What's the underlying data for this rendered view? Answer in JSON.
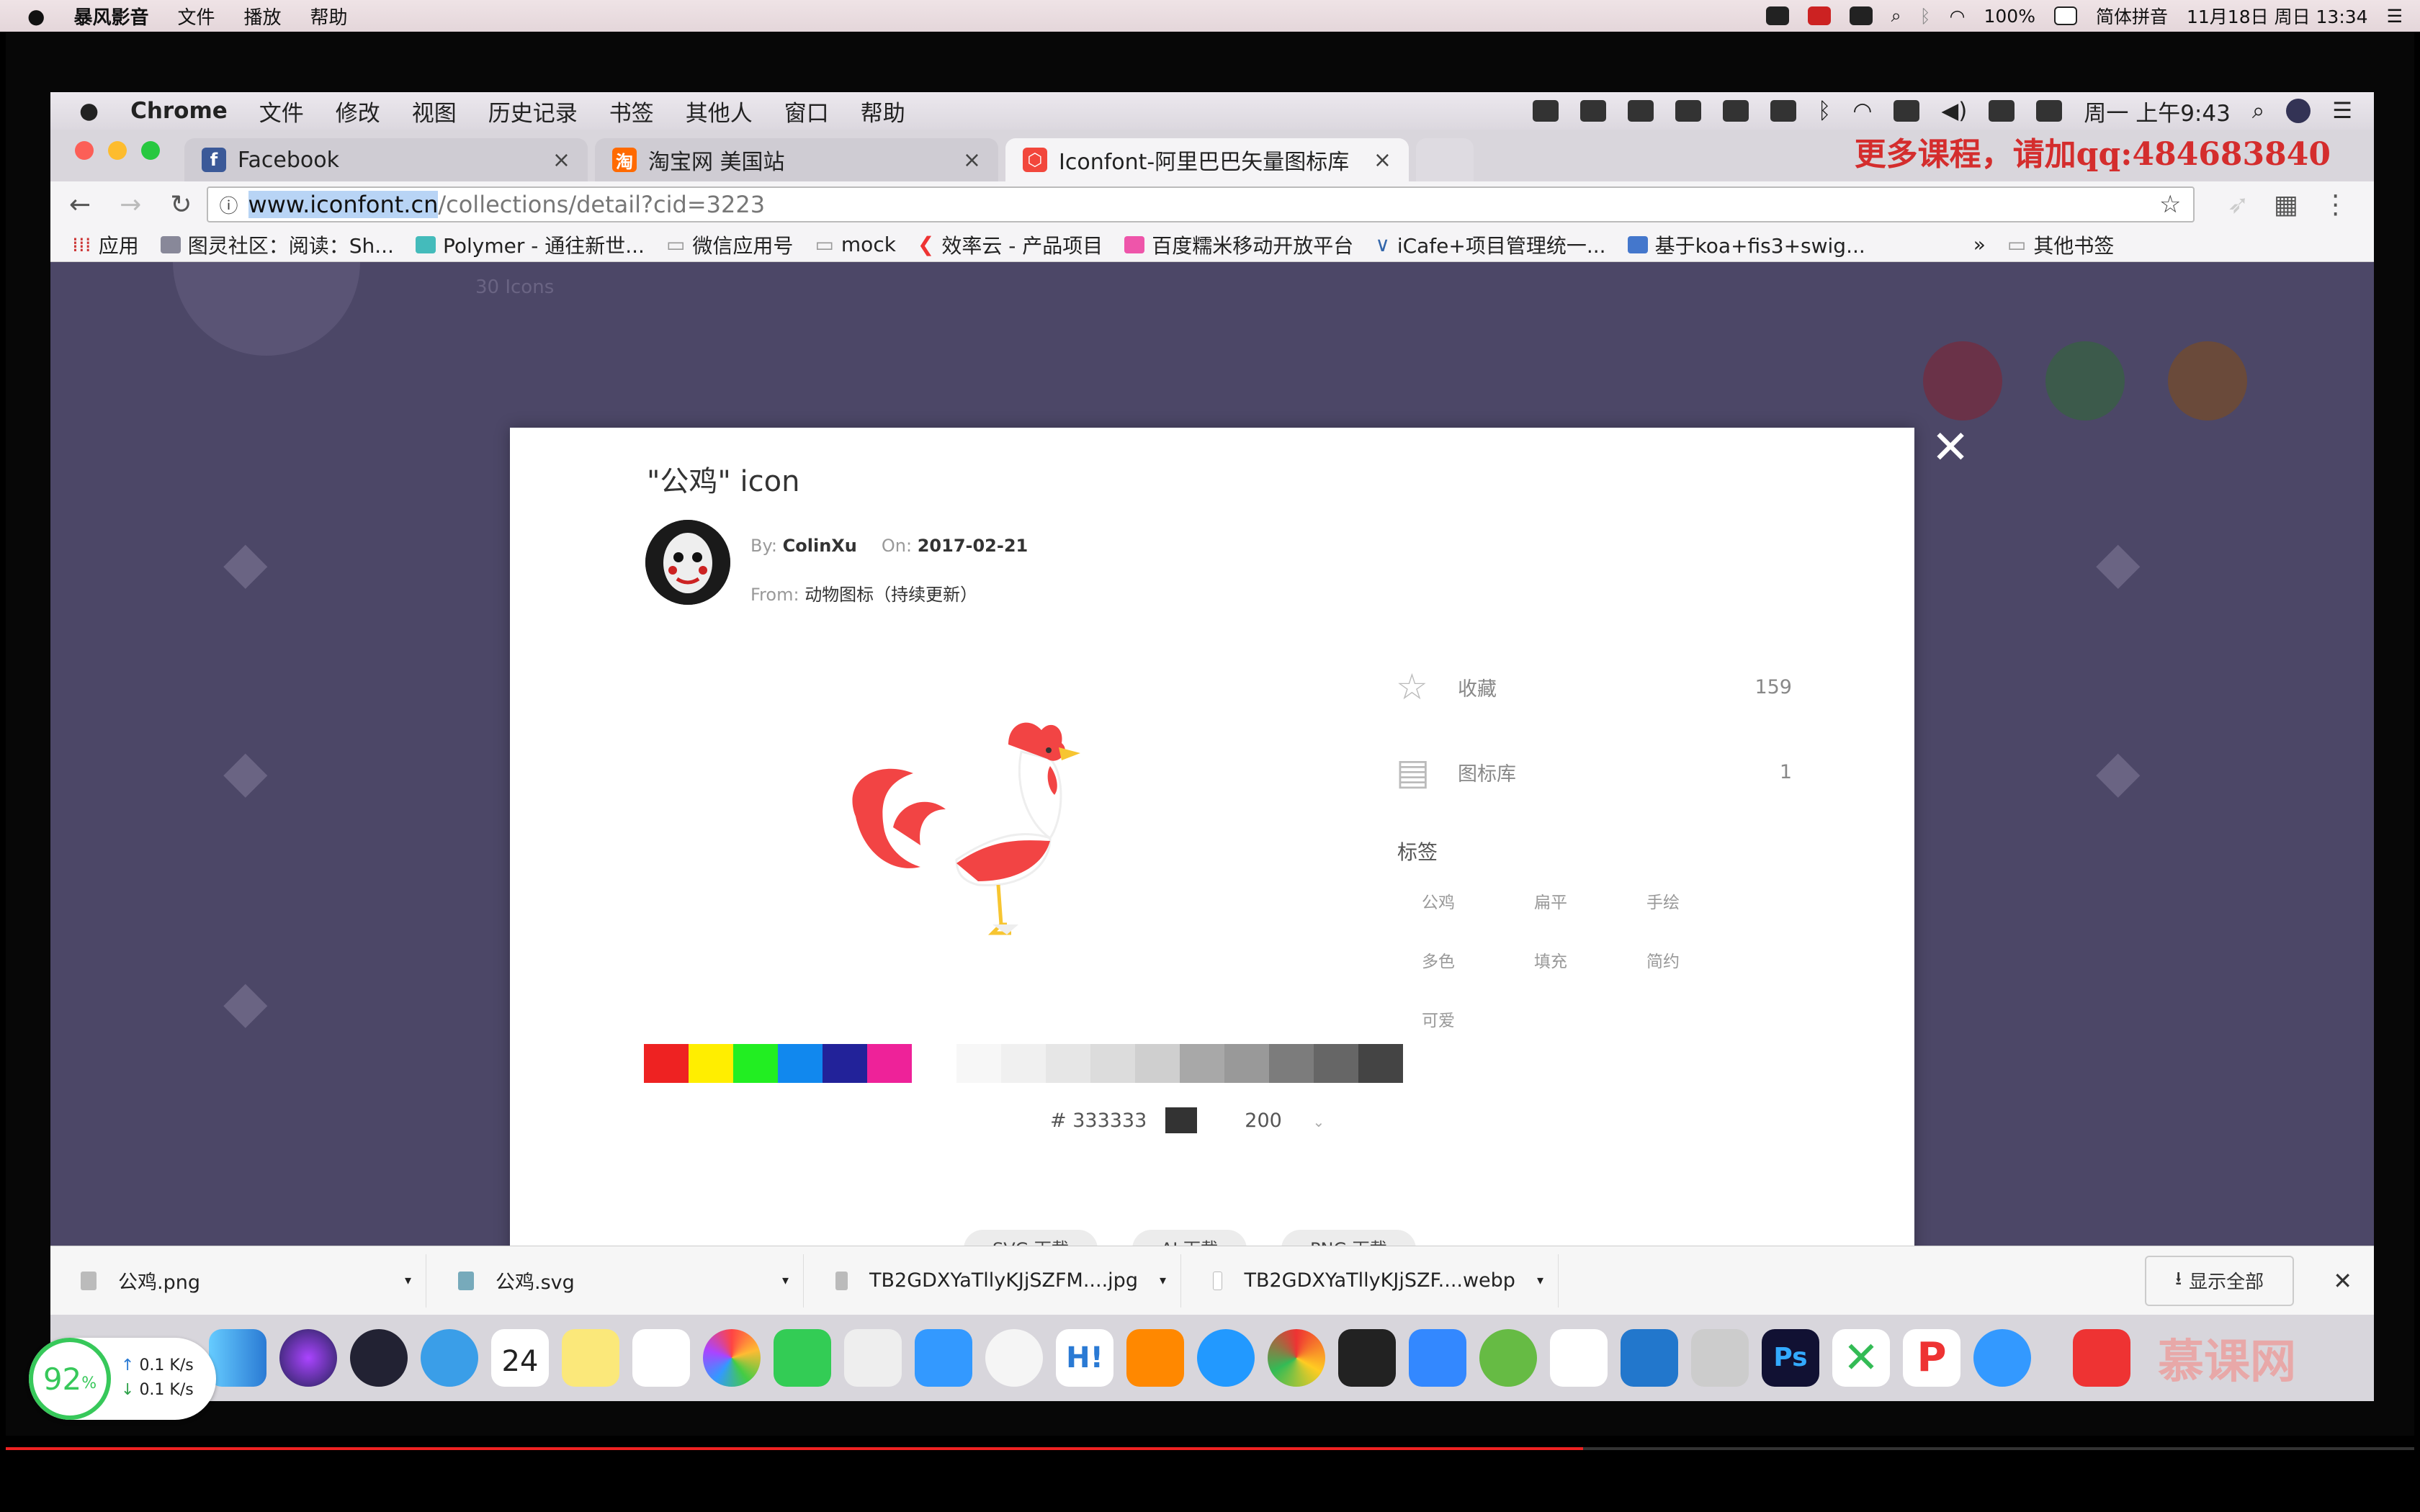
{
  "host": {
    "menus": [
      "暴风影音",
      "文件",
      "播放",
      "帮助"
    ],
    "status_right": [
      "100%",
      "简体拼音",
      "11月18日 周日 13:34"
    ]
  },
  "mac": {
    "menubar": {
      "app": "Chrome",
      "items": [
        "文件",
        "修改",
        "视图",
        "历史记录",
        "书签",
        "其他人",
        "窗口",
        "帮助"
      ],
      "clock": "周一 上午9:43"
    },
    "tabs": [
      {
        "title": "Facebook",
        "favicon_color": "#3b5998",
        "favicon": "f"
      },
      {
        "title": "淘宝网 美国站",
        "favicon_color": "#ff6a00",
        "favicon": "淘"
      },
      {
        "title": "Iconfont-阿里巴巴矢量图标库",
        "favicon_color": "#f2473c",
        "favicon": "⬡"
      }
    ],
    "promo": "更多课程，请加qq:484683840",
    "url": {
      "highlight": "www.iconfont.cn",
      "rest": "/collections/detail?cid=3223"
    },
    "bookmarks": [
      "应用",
      "图灵社区：阅读：Sh...",
      "Polymer - 通往新世...",
      "微信应用号",
      "mock",
      "效率云 - 产品项目",
      "百度糯米移动开放平台",
      "iCafe+项目管理统一...",
      "基于koa+fis3+swig...",
      "其他书签"
    ],
    "bg_text": "30 Icons"
  },
  "modal": {
    "title": "\"公鸡\" icon",
    "by_label": "By:",
    "author": "ColinXu",
    "on_label": "On:",
    "date": "2017-02-21",
    "from_label": "From:",
    "from": "动物图标（持续更新）",
    "stats": [
      {
        "icon": "star-icon",
        "label": "收藏",
        "count": "159"
      },
      {
        "icon": "folder-icon",
        "label": "图标库",
        "count": "1"
      }
    ],
    "tags_heading": "标签",
    "tags": [
      "公鸡",
      "扁平",
      "手绘",
      "多色",
      "填充",
      "简约",
      "可爱"
    ],
    "palette": [
      "#ee2222",
      "#ffee00",
      "#22ee22",
      "#1188ee",
      "#222299",
      "#ee2299"
    ],
    "grays": [
      "#f7f7f7",
      "#f0f0f0",
      "#e6e6e6",
      "#dcdcdc",
      "#cfcfcf",
      "#a8a8a8",
      "#999999",
      "#7c7c7c",
      "#666666",
      "#444444"
    ],
    "color_hash": "#",
    "color_value": "333333",
    "size": "200",
    "buttons": [
      "SVG 下载",
      "AI 下载",
      "PNG 下载"
    ]
  },
  "downloads": {
    "items": [
      "公鸡.png",
      "公鸡.svg",
      "TB2GDXYaTllyKJjSZFM....jpg",
      "TB2GDXYaTllyKJjSZF....webp"
    ],
    "show_all": "显示全部"
  },
  "dock": {
    "calendar_day": "24",
    "watermark": "慕课网"
  },
  "overlay": {
    "percent": "92",
    "percent_sign": "%",
    "up": "0.1 K/s",
    "down": "0.1 K/s",
    "progress": 0.655
  }
}
